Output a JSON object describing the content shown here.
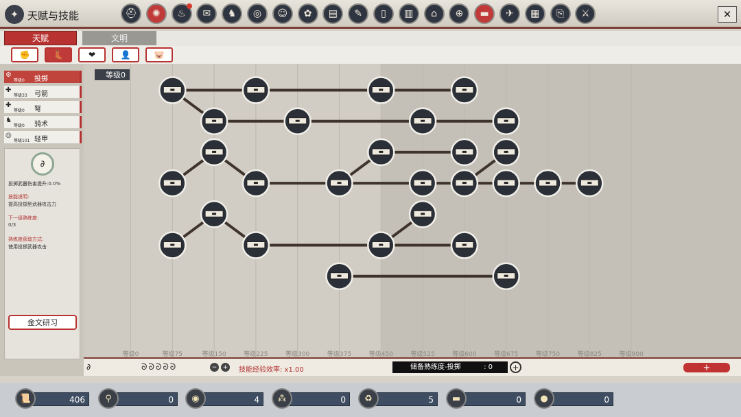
{
  "app": {
    "title": "天赋与技能",
    "logo_icon": "skill-tree-icon"
  },
  "top_icons": [
    "helmet-icon",
    "skills-icon",
    "rooster-icon",
    "document-icon",
    "horse-icon",
    "compass-icon",
    "face-icon",
    "phoenix-icon",
    "book-icon",
    "scroll-icon",
    "tablet-icon",
    "buildings-icon",
    "temple-icon",
    "seal-icon",
    "tome-icon",
    "bird-icon",
    "gate-icon",
    "map-icon",
    "sword-icon"
  ],
  "tabs": {
    "talent": "天赋",
    "civilization": "文明"
  },
  "categories": [
    "✊",
    "👢",
    "❤",
    "👤",
    "🐷"
  ],
  "skills": [
    {
      "name": "投掷",
      "level": "等级0",
      "icon": "⚙"
    },
    {
      "name": "弓箭",
      "level": "等级33",
      "icon": "✚"
    },
    {
      "name": "弩",
      "level": "等级0",
      "icon": "✚"
    },
    {
      "name": "骑术",
      "level": "等级0",
      "icon": "♞"
    },
    {
      "name": "轻甲",
      "level": "等级101",
      "icon": "◎"
    }
  ],
  "detail": {
    "icon": "∂",
    "bonus": "投掷武器伤害提升:0.0%",
    "desc_label": "技能说明:",
    "desc": "提高投掷型武器攻击力",
    "next_label": "下一级熟练度:",
    "next_value": "0/3",
    "method_label": "熟练度获取方式:",
    "method": "使用投掷武器攻击",
    "research_button": "金文研习"
  },
  "tree": {
    "level_tag": "等级0",
    "axis": [
      "等级0",
      "等级75",
      "等级150",
      "等级225",
      "等级300",
      "等级375",
      "等级450",
      "等级525",
      "等级600",
      "等级675",
      "等级750",
      "等级825",
      "等级900"
    ],
    "nodes": [
      {
        "id": "a",
        "col": 2,
        "row": 1
      },
      {
        "id": "b",
        "col": 4,
        "row": 1
      },
      {
        "id": "c",
        "col": 7,
        "row": 1
      },
      {
        "id": "d",
        "col": 9,
        "row": 1
      },
      {
        "id": "e",
        "col": 3,
        "row": 2
      },
      {
        "id": "f",
        "col": 5,
        "row": 2
      },
      {
        "id": "g",
        "col": 8,
        "row": 2
      },
      {
        "id": "h",
        "col": 10,
        "row": 2
      },
      {
        "id": "i",
        "col": 3,
        "row": 3
      },
      {
        "id": "j",
        "col": 7,
        "row": 3
      },
      {
        "id": "k",
        "col": 9,
        "row": 3
      },
      {
        "id": "l",
        "col": 10,
        "row": 3
      },
      {
        "id": "m",
        "col": 2,
        "row": 4
      },
      {
        "id": "n",
        "col": 4,
        "row": 4
      },
      {
        "id": "o",
        "col": 6,
        "row": 4
      },
      {
        "id": "p",
        "col": 8,
        "row": 4
      },
      {
        "id": "q",
        "col": 9,
        "row": 4
      },
      {
        "id": "r",
        "col": 10,
        "row": 4
      },
      {
        "id": "s",
        "col": 11,
        "row": 4
      },
      {
        "id": "t",
        "col": 12,
        "row": 4
      },
      {
        "id": "u",
        "col": 3,
        "row": 5
      },
      {
        "id": "v",
        "col": 8,
        "row": 5
      },
      {
        "id": "w",
        "col": 2,
        "row": 6
      },
      {
        "id": "x",
        "col": 4,
        "row": 6
      },
      {
        "id": "y",
        "col": 7,
        "row": 6
      },
      {
        "id": "z",
        "col": 9,
        "row": 6
      },
      {
        "id": "aa",
        "col": 6,
        "row": 7
      },
      {
        "id": "bb",
        "col": 10,
        "row": 7
      }
    ],
    "edges": [
      [
        "a",
        "b"
      ],
      [
        "b",
        "c"
      ],
      [
        "c",
        "d"
      ],
      [
        "a",
        "e"
      ],
      [
        "e",
        "f"
      ],
      [
        "f",
        "g"
      ],
      [
        "g",
        "h"
      ],
      [
        "i",
        "m"
      ],
      [
        "i",
        "n"
      ],
      [
        "n",
        "o"
      ],
      [
        "o",
        "j"
      ],
      [
        "j",
        "k"
      ],
      [
        "o",
        "p"
      ],
      [
        "p",
        "q"
      ],
      [
        "q",
        "r"
      ],
      [
        "r",
        "s"
      ],
      [
        "s",
        "t"
      ],
      [
        "q",
        "l"
      ],
      [
        "u",
        "w"
      ],
      [
        "u",
        "x"
      ],
      [
        "x",
        "y"
      ],
      [
        "y",
        "v"
      ],
      [
        "y",
        "z"
      ],
      [
        "aa",
        "bb"
      ]
    ]
  },
  "bottom": {
    "icon": "∂",
    "dots": "ᘐᘐᘐᘐᘐ",
    "minus": "−",
    "plus": "+",
    "exp_rate": "技能经验效率: x1.00",
    "stock_label": "储备熟练度-投掷",
    "stock_value": ": 0",
    "stock_plus": "+",
    "red_plus": "+"
  },
  "resources": [
    {
      "icon": "scroll-icon",
      "glyph": "📜",
      "value": "406"
    },
    {
      "icon": "pillar-icon",
      "glyph": "⚲",
      "value": "0"
    },
    {
      "icon": "coin-swirl-icon",
      "glyph": "◉",
      "value": "4"
    },
    {
      "icon": "cluster-icon",
      "glyph": "⁂",
      "value": "0"
    },
    {
      "icon": "cycle-icon",
      "glyph": "♻",
      "value": "5"
    },
    {
      "icon": "anvil-icon",
      "glyph": "▬",
      "value": "0"
    },
    {
      "icon": "gold-coin-icon",
      "glyph": "●",
      "value": "0"
    }
  ],
  "colors": {
    "accent": "#b83232",
    "node": "#2b2f37",
    "line": "#3f342c"
  }
}
